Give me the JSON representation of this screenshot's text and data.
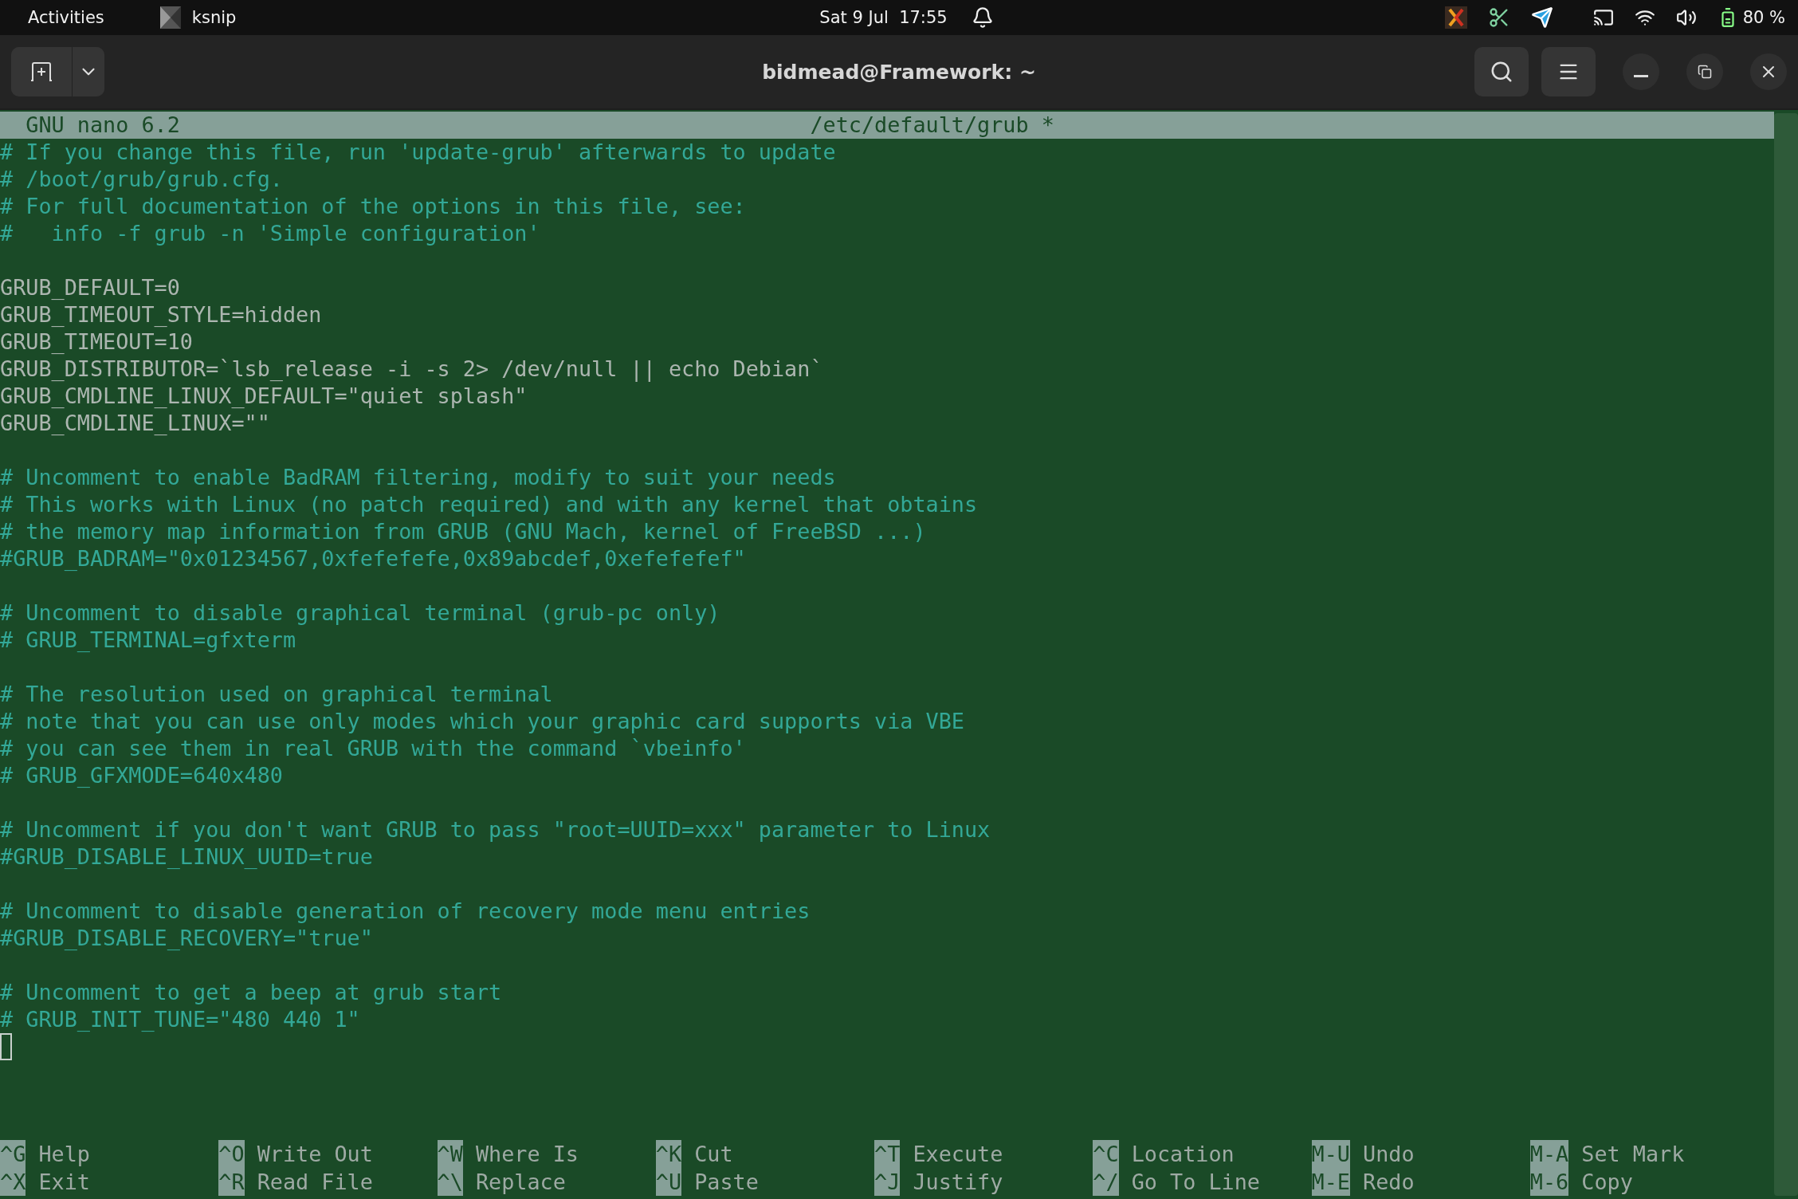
{
  "top_bar": {
    "activities": "Activities",
    "app": "ksnip",
    "clock": "Sat 9 Jul  17:55",
    "battery": "80 %"
  },
  "window": {
    "title": "bidmead@Framework: ~"
  },
  "nano": {
    "version": "GNU nano 6.2",
    "file": "/etc/default/grub *",
    "lines": [
      {
        "kind": "comment",
        "text": "# If you change this file, run 'update-grub' afterwards to update"
      },
      {
        "kind": "comment",
        "text": "# /boot/grub/grub.cfg."
      },
      {
        "kind": "comment",
        "text": "# For full documentation of the options in this file, see:"
      },
      {
        "kind": "comment",
        "text": "#   info -f grub -n 'Simple configuration'"
      },
      {
        "kind": "blank"
      },
      {
        "kind": "setting",
        "text": "GRUB_DEFAULT=0"
      },
      {
        "kind": "setting",
        "text": "GRUB_TIMEOUT_STYLE=hidden"
      },
      {
        "kind": "setting",
        "text": "GRUB_TIMEOUT=10"
      },
      {
        "kind": "setting",
        "text": "GRUB_DISTRIBUTOR=`lsb_release -i -s 2> /dev/null || echo Debian`"
      },
      {
        "kind": "setting",
        "text": "GRUB_CMDLINE_LINUX_DEFAULT=\"quiet splash\""
      },
      {
        "kind": "setting",
        "text": "GRUB_CMDLINE_LINUX=\"\""
      },
      {
        "kind": "blank"
      },
      {
        "kind": "comment",
        "text": "# Uncomment to enable BadRAM filtering, modify to suit your needs"
      },
      {
        "kind": "comment",
        "text": "# This works with Linux (no patch required) and with any kernel that obtains"
      },
      {
        "kind": "comment",
        "text": "# the memory map information from GRUB (GNU Mach, kernel of FreeBSD ...)"
      },
      {
        "kind": "comment",
        "text": "#GRUB_BADRAM=\"0x01234567,0xfefefefe,0x89abcdef,0xefefefef\""
      },
      {
        "kind": "blank"
      },
      {
        "kind": "comment",
        "text": "# Uncomment to disable graphical terminal (grub-pc only)"
      },
      {
        "kind": "comment",
        "text": "# GRUB_TERMINAL=gfxterm"
      },
      {
        "kind": "blank"
      },
      {
        "kind": "comment",
        "text": "# The resolution used on graphical terminal"
      },
      {
        "kind": "comment",
        "text": "# note that you can use only modes which your graphic card supports via VBE"
      },
      {
        "kind": "comment",
        "text": "# you can see them in real GRUB with the command `vbeinfo'"
      },
      {
        "kind": "comment",
        "text": "# GRUB_GFXMODE=640x480"
      },
      {
        "kind": "blank"
      },
      {
        "kind": "comment",
        "text": "# Uncomment if you don't want GRUB to pass \"root=UUID=xxx\" parameter to Linux"
      },
      {
        "kind": "comment",
        "text": "#GRUB_DISABLE_LINUX_UUID=true"
      },
      {
        "kind": "blank"
      },
      {
        "kind": "comment",
        "text": "# Uncomment to disable generation of recovery mode menu entries"
      },
      {
        "kind": "comment",
        "text": "#GRUB_DISABLE_RECOVERY=\"true\""
      },
      {
        "kind": "blank"
      },
      {
        "kind": "comment",
        "text": "# Uncomment to get a beep at grub start"
      },
      {
        "kind": "comment",
        "text": "# GRUB_INIT_TUNE=\"480 440 1\""
      },
      {
        "kind": "cursor"
      }
    ],
    "shortcuts": [
      [
        {
          "key": "^G",
          "label": "Help"
        },
        {
          "key": "^O",
          "label": "Write Out"
        },
        {
          "key": "^W",
          "label": "Where Is"
        },
        {
          "key": "^K",
          "label": "Cut"
        },
        {
          "key": "^T",
          "label": "Execute"
        },
        {
          "key": "^C",
          "label": "Location"
        },
        {
          "key": "M-U",
          "label": "Undo"
        },
        {
          "key": "M-A",
          "label": "Set Mark"
        }
      ],
      [
        {
          "key": "^X",
          "label": "Exit"
        },
        {
          "key": "^R",
          "label": "Read File"
        },
        {
          "key": "^\\",
          "label": "Replace"
        },
        {
          "key": "^U",
          "label": "Paste"
        },
        {
          "key": "^J",
          "label": "Justify"
        },
        {
          "key": "^/",
          "label": "Go To Line"
        },
        {
          "key": "M-E",
          "label": "Redo"
        },
        {
          "key": "M-6",
          "label": "Copy"
        }
      ]
    ]
  }
}
